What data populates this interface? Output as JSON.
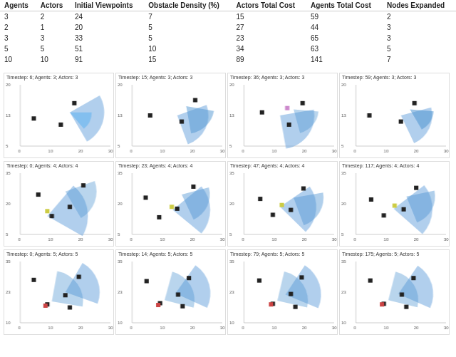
{
  "table": {
    "headers": [
      "Agents",
      "Actors",
      "Initial Viewpoints",
      "Obstacle Density (%)",
      "Actors Total Cost",
      "Agents Total Cost",
      "Nodes Expanded"
    ],
    "rows": [
      [
        3,
        2,
        24,
        7,
        15,
        59,
        2
      ],
      [
        2,
        1,
        20,
        5,
        27,
        44,
        3
      ],
      [
        3,
        3,
        33,
        5,
        23,
        65,
        3
      ],
      [
        5,
        5,
        51,
        10,
        34,
        63,
        5
      ],
      [
        10,
        10,
        91,
        15,
        89,
        141,
        7
      ]
    ]
  },
  "plots": {
    "rows": [
      [
        {
          "title": "Timestep: 6; Agents: 3; Actors: 3",
          "ymax": 20,
          "ymin": 5
        },
        {
          "title": "Timestep: 15; Agents: 3; Actors: 3",
          "ymax": 20,
          "ymin": 5
        },
        {
          "title": "Timestep: 36; Agents: 3; Actors: 3",
          "ymax": 20,
          "ymin": 5
        },
        {
          "title": "Timestep: 59; Agents: 3; Actors: 3",
          "ymax": 20,
          "ymin": 5
        }
      ],
      [
        {
          "title": "Timestep: 0; Agents: 4; Actors: 4",
          "ymax": 35,
          "ymin": 5
        },
        {
          "title": "Timestep: 23; Agents: 4; Actors: 4",
          "ymax": 35,
          "ymin": 5
        },
        {
          "title": "Timestep: 47; Agents: 4; Actors: 4",
          "ymax": 35,
          "ymin": 5
        },
        {
          "title": "Timestep: 117; Agents: 4; Actors: 4",
          "ymax": 35,
          "ymin": 5
        }
      ],
      [
        {
          "title": "Timestep: 0; Agents: 5; Actors: 5",
          "ymax": 35,
          "ymin": 10
        },
        {
          "title": "Timestep: 14; Agents: 5; Actors: 5",
          "ymax": 35,
          "ymin": 10
        },
        {
          "title": "Timestep: 79; Agents: 5; Actors: 5",
          "ymax": 35,
          "ymin": 10
        },
        {
          "title": "Timestep: 175; Agents: 5; Actors: 5",
          "ymax": 35,
          "ymin": 10
        }
      ]
    ]
  }
}
